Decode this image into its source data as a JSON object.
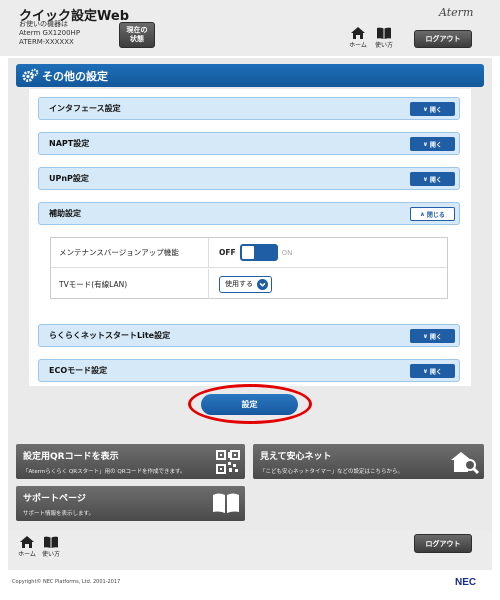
{
  "header": {
    "title": "クイック設定Web",
    "device_caption": "お使いの機器は",
    "device_model": "Aterm GX1200HP",
    "device_name": "ATERM-XXXXXX",
    "status_label_1": "現在の",
    "status_label_2": "状態",
    "logo": "Aterm",
    "home_label": "ホーム",
    "howto_label": "使い方",
    "logout_label": "ログアウト"
  },
  "section": {
    "title": "その他の設定"
  },
  "rows": [
    {
      "label": "インタフェース設定",
      "button": "開く"
    },
    {
      "label": "NAPT設定",
      "button": "開く"
    },
    {
      "label": "UPnP設定",
      "button": "開く"
    },
    {
      "label": "補助設定",
      "button": "閉じる"
    },
    {
      "label": "らくらくネットスタートLite設定",
      "button": "開く"
    },
    {
      "label": "ECOモード設定",
      "button": "開く"
    }
  ],
  "aux": {
    "maintenance_label": "メンテナンスバージョンアップ機能",
    "toggle_off": "OFF",
    "toggle_on": "ON",
    "tv_label": "TVモード(有線LAN)",
    "tv_value": "使用する"
  },
  "submit_label": "設定",
  "tiles": [
    {
      "title": "設定用QRコードを表示",
      "desc": "「Atermらくらく QRスタート」用の QRコードを作成できます。"
    },
    {
      "title": "見えて安心ネット",
      "desc": "「こども安心ネットタイマー」などの設定はこちらから。"
    },
    {
      "title": "サポートページ",
      "desc": "サポート情報を表示します。"
    }
  ],
  "footer": {
    "home_label": "ホーム",
    "howto_label": "使い方",
    "logout_label": "ログアウト",
    "copyright": "Copyright© NEC Platforms, Ltd. 2001-2017",
    "brand": "NEC"
  },
  "colors": {
    "accent": "#1f5ea5",
    "highlight": "#e20000",
    "row_bg": "#d6e9f8"
  }
}
